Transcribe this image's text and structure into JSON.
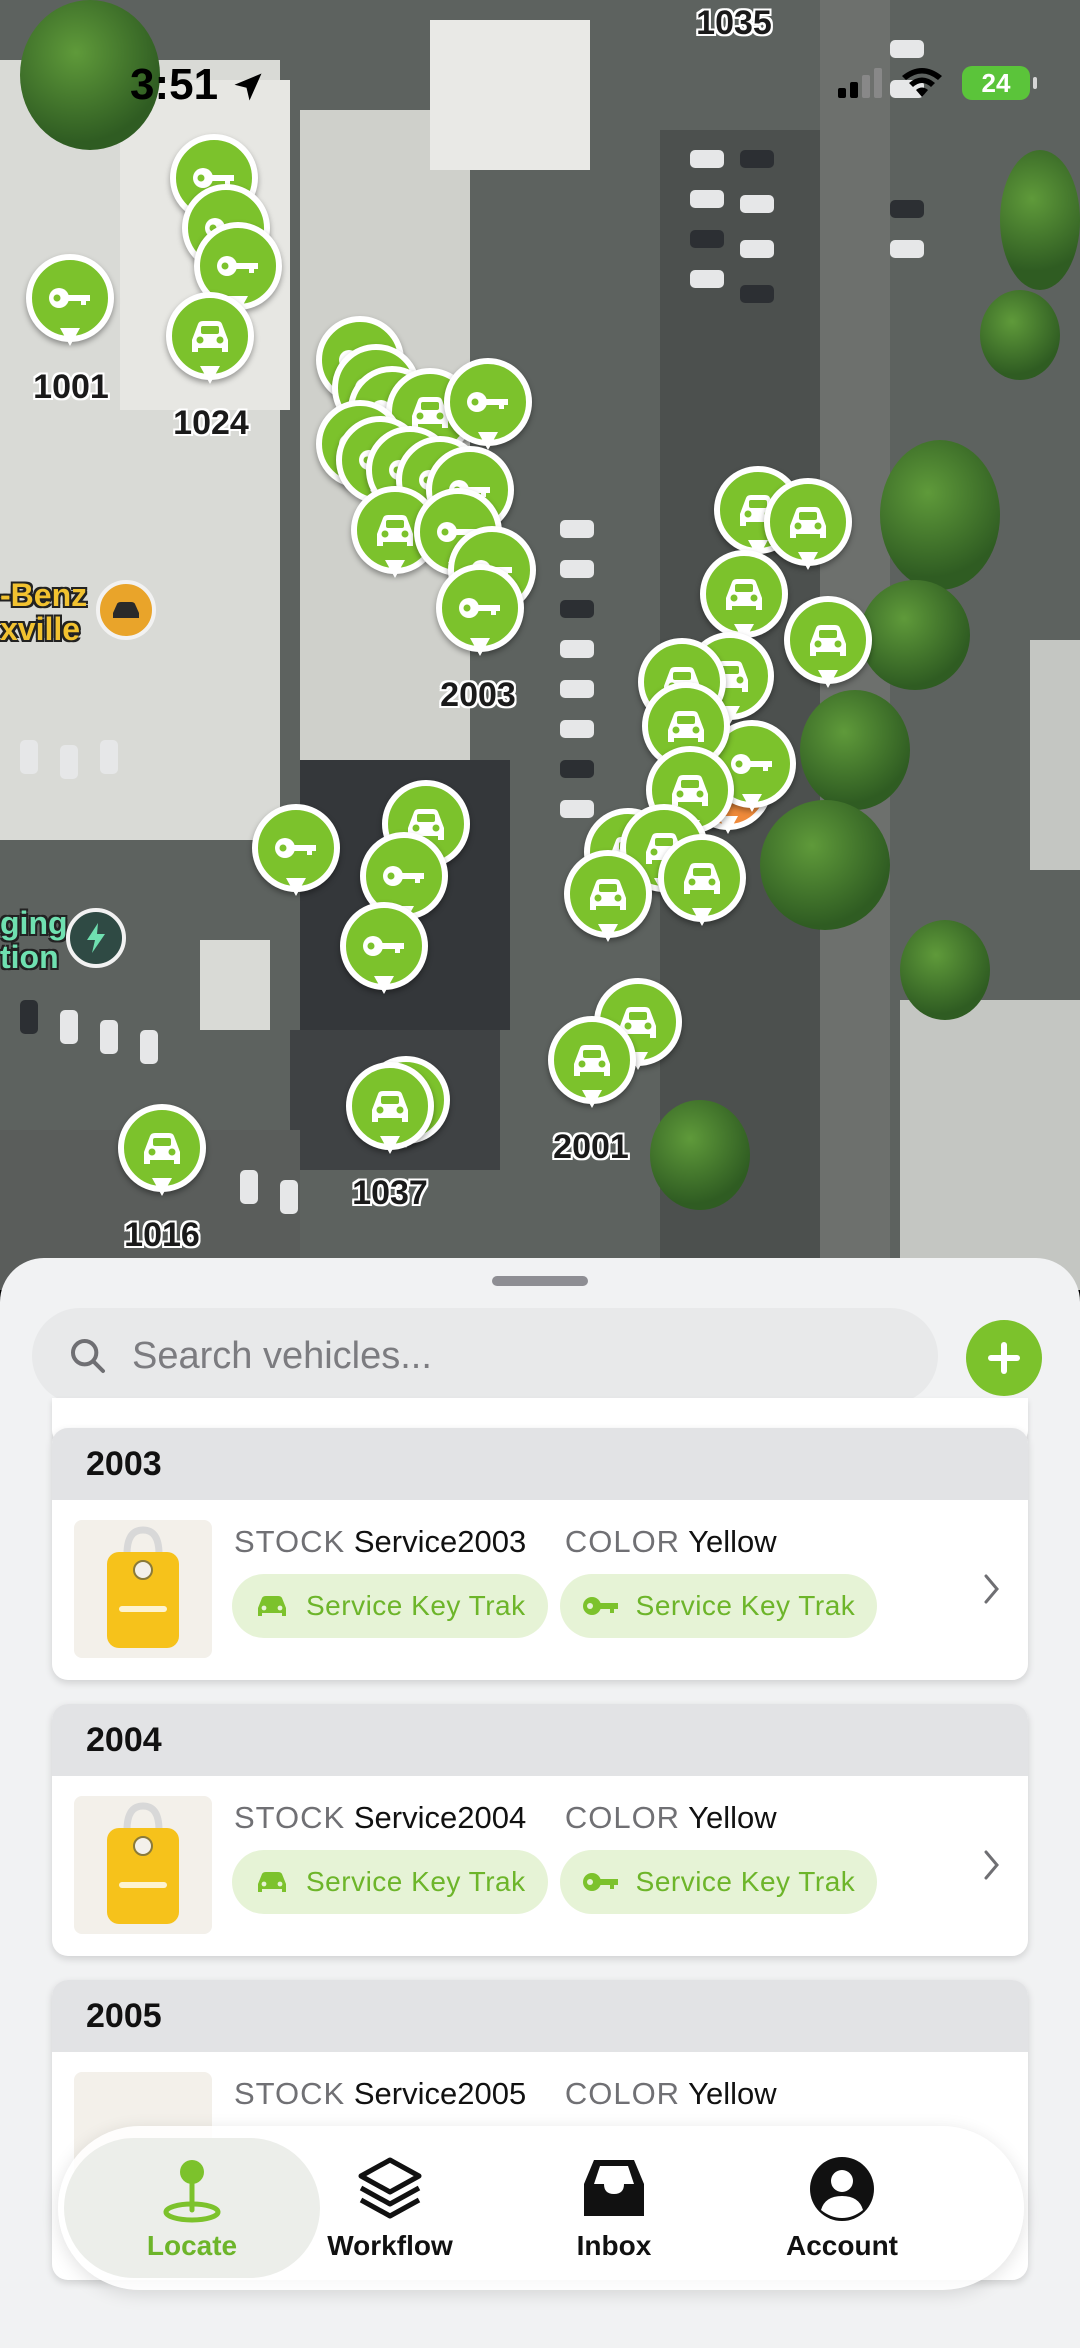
{
  "status_bar": {
    "time": "3:51",
    "battery": "24"
  },
  "map": {
    "colors": {
      "pin_green": "#7cc22c",
      "pin_orange": "#ef8a3a"
    },
    "pin_labels": [
      "1035",
      "1001",
      "1024",
      "2003",
      "2001",
      "1037",
      "1016"
    ],
    "poi_labels": {
      "mercedes_line1": "-Benz",
      "mercedes_line2": "xville",
      "charging_line1": "ging",
      "charging_line2": "tion"
    }
  },
  "search": {
    "placeholder": "Search vehicles..."
  },
  "list": {
    "stock_key": "STOCK",
    "color_key": "COLOR",
    "groups": [
      {
        "title": "2003",
        "stock": "Service2003",
        "color": "Yellow",
        "chip1": "Service Key Trak",
        "chip2": "Service Key Trak"
      },
      {
        "title": "2004",
        "stock": "Service2004",
        "color": "Yellow",
        "chip1": "Service Key Trak",
        "chip2": "Service Key Trak"
      },
      {
        "title": "2005",
        "stock": "Service2005",
        "color": "Yellow"
      }
    ]
  },
  "tabs": [
    {
      "label": "Locate",
      "icon": "location-pin-icon",
      "active": true
    },
    {
      "label": "Workflow",
      "icon": "layers-icon"
    },
    {
      "label": "Inbox",
      "icon": "inbox-tray-icon"
    },
    {
      "label": "Account",
      "icon": "person-circle-icon"
    }
  ]
}
